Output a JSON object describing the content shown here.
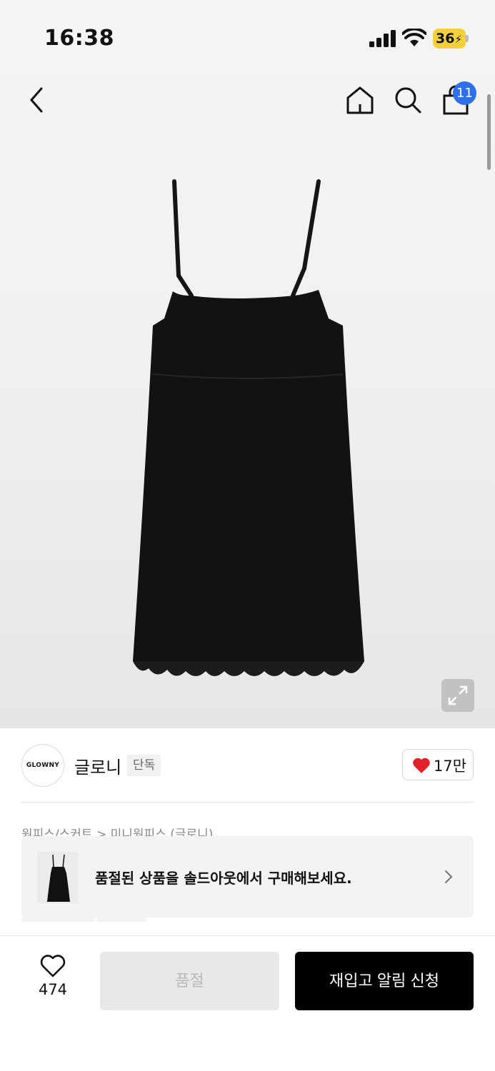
{
  "status_bar": {
    "time": "16:38",
    "battery": "36",
    "icons": [
      "signal-icon",
      "wifi-icon",
      "battery-icon"
    ]
  },
  "nav": {
    "icons": [
      "back-icon",
      "home-icon",
      "search-icon",
      "bag-icon"
    ],
    "bag_badge": "11"
  },
  "product_image": {
    "icon": "expand-icon"
  },
  "brand": {
    "logo_text": "GLOWNY",
    "name": "글로니",
    "tag": "단독"
  },
  "likes": {
    "count": "17만",
    "icon": "heart-filled-icon",
    "color": "#e5202b"
  },
  "breadcrumb": "원피스/스커트 > 미니원피스 (글로니)",
  "soldout_banner": {
    "text": "품절된 상품을 솔드아웃에서 구매해보세요.",
    "icon": "chevron-right-icon"
  },
  "bottom_bar": {
    "wish_count": "474",
    "wish_icon": "heart-outline-icon",
    "soldout_label": "품절",
    "restock_label": "재입고 알림 신청"
  },
  "colors": {
    "badge": "#2f6fe8",
    "primary_button": "#000000",
    "disabled_button": "#e8e8e8"
  }
}
